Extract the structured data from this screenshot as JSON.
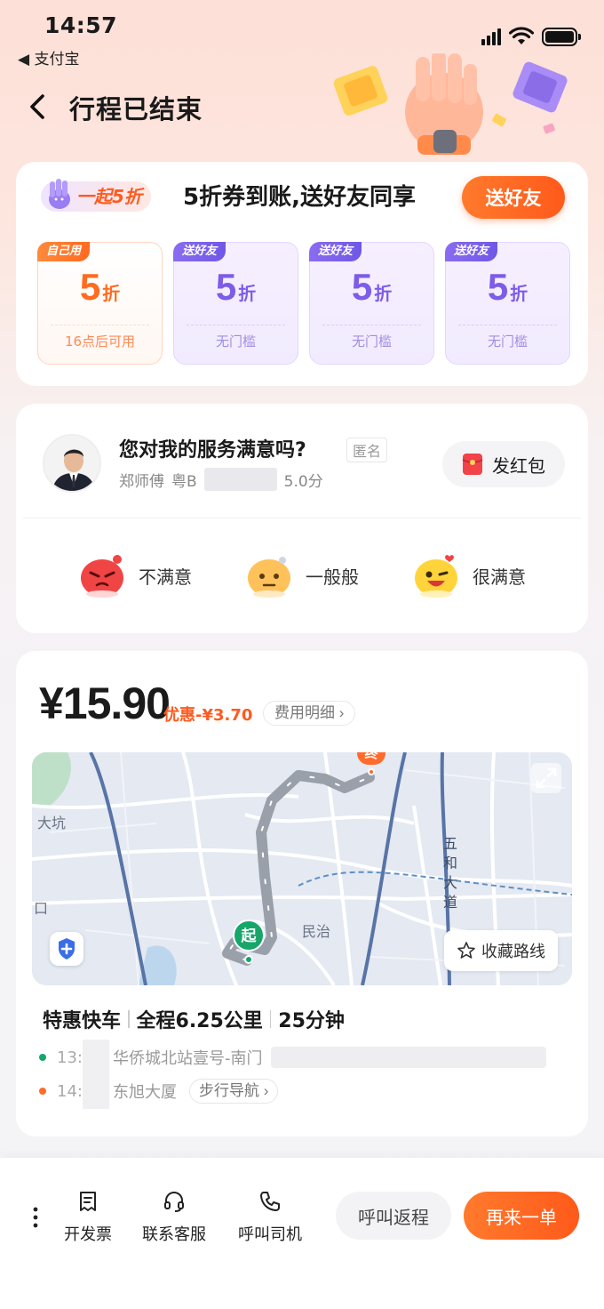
{
  "status_bar": {
    "time": "14:57",
    "back_app": "◀ 支付宝"
  },
  "header": {
    "title": "行程已结束"
  },
  "coupon_section": {
    "badge": "一起5折",
    "headline": "5折券到账,送好友同享",
    "send_button": "送好友",
    "coupons": [
      {
        "tag": "自己用",
        "value": "5",
        "unit": "折",
        "condition": "16点后可用",
        "kind": "own"
      },
      {
        "tag": "送好友",
        "value": "5",
        "unit": "折",
        "condition": "无门槛",
        "kind": "gift"
      },
      {
        "tag": "送好友",
        "value": "5",
        "unit": "折",
        "condition": "无门槛",
        "kind": "gift"
      },
      {
        "tag": "送好友",
        "value": "5",
        "unit": "折",
        "condition": "无门槛",
        "kind": "gift"
      }
    ]
  },
  "rating_section": {
    "question": "您对我的服务满意吗?",
    "anonymous": "匿名",
    "driver_name": "郑师傅",
    "plate_prefix": "粤B",
    "score": "5.0分",
    "red_packet_button": "发红包",
    "options": [
      {
        "label": "不满意",
        "icon": "angry-face-icon"
      },
      {
        "label": "一般般",
        "icon": "neutral-face-icon"
      },
      {
        "label": "很满意",
        "icon": "happy-face-icon"
      }
    ]
  },
  "trip_section": {
    "price": "¥15.90",
    "discount": "优惠-¥3.70",
    "fee_detail": "费用明细 ›",
    "map": {
      "labels": {
        "dakeng": "大坑",
        "minzhi": "民治",
        "road": [
          "五",
          "和",
          "大",
          "道"
        ],
        "edge": "口"
      },
      "start_marker": "起",
      "end_marker": "终",
      "save_route": "收藏路线"
    },
    "summary": {
      "service": "特惠快车",
      "distance": "全程6.25公里",
      "duration": "25分钟"
    },
    "start_stop": {
      "time_prefix": "13:",
      "place": "华侨城北站壹号-南门"
    },
    "end_stop": {
      "time_prefix": "14:",
      "place": "东旭大厦",
      "nav_button": "步行导航 ›"
    }
  },
  "bottom_bar": {
    "invoice": "开发票",
    "support": "联系客服",
    "call_driver": "呼叫司机",
    "return_trip": "呼叫返程",
    "order_again": "再来一单"
  },
  "colors": {
    "accent": "#ff5a1b",
    "gift_purple": "#7d5ce8",
    "start_green": "#17a66a",
    "end_orange": "#ff6b2c"
  }
}
